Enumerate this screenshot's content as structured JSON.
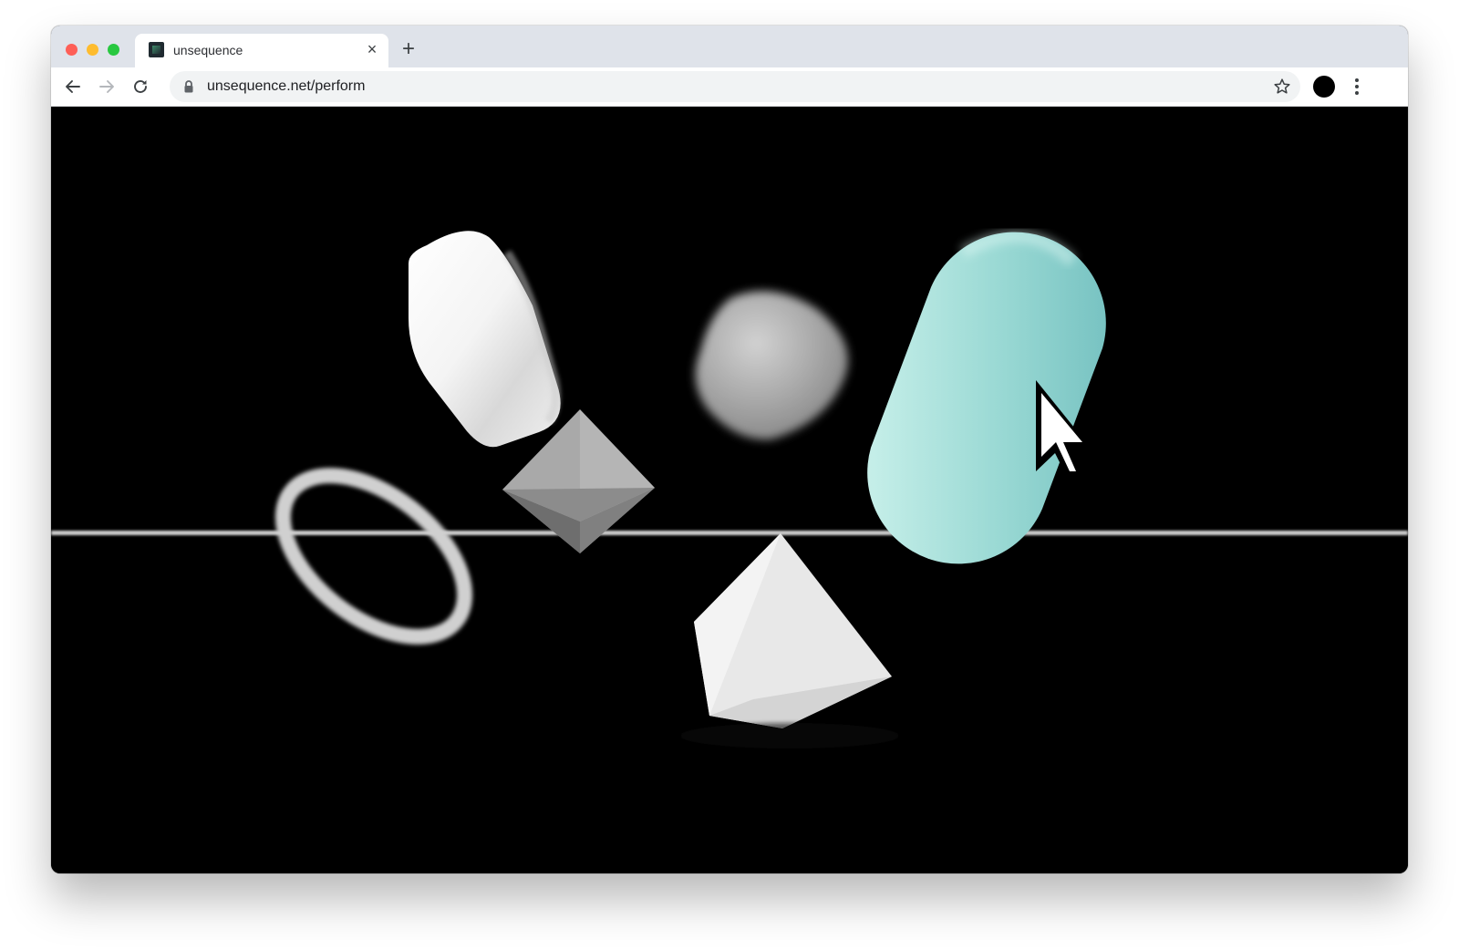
{
  "browser": {
    "tab": {
      "title": "unsequence",
      "close_glyph": "×",
      "favicon": "unsequence-favicon"
    },
    "new_tab_glyph": "+",
    "address_bar": {
      "url": "unsequence.net/perform"
    },
    "icons": {
      "back": "back-arrow-icon",
      "forward": "forward-arrow-icon",
      "reload": "reload-icon",
      "lock": "lock-icon",
      "bookmark": "star-icon",
      "profile": "profile-avatar",
      "menu": "kebab-menu-icon"
    }
  },
  "scene": {
    "background_color": "#000000",
    "accent_color": "#8fd3cf",
    "objects": [
      "rounded-white-box",
      "blurred-grey-cube",
      "teal-capsule",
      "grey-octahedron",
      "blurred-torus-ring",
      "white-pyramid",
      "horizon-line"
    ],
    "cursor": "pixel-arrow-cursor"
  }
}
